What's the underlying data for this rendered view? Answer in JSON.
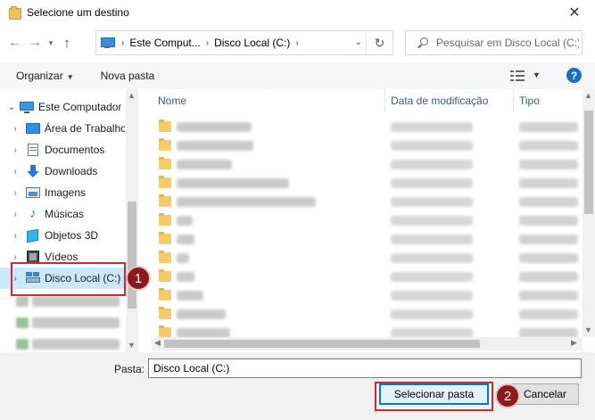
{
  "window": {
    "title": "Selecione um destino"
  },
  "address": {
    "crumbs": [
      "Este Comput...",
      "Disco Local (C:)"
    ],
    "search_placeholder": "Pesquisar em Disco Local (C:)"
  },
  "toolbar": {
    "organize": "Organizar",
    "new_folder": "Nova pasta"
  },
  "nav": {
    "items": [
      {
        "label": "Este Computador",
        "icon": "computer-icon"
      },
      {
        "label": "Área de Trabalho",
        "icon": "desktop-icon"
      },
      {
        "label": "Documentos",
        "icon": "documents-icon"
      },
      {
        "label": "Downloads",
        "icon": "downloads-icon"
      },
      {
        "label": "Imagens",
        "icon": "pictures-icon"
      },
      {
        "label": "Músicas",
        "icon": "music-icon"
      },
      {
        "label": "Objetos 3D",
        "icon": "objects-3d-icon"
      },
      {
        "label": "Vídeos",
        "icon": "videos-icon"
      },
      {
        "label": "Disco Local (C:)",
        "icon": "drive-icon"
      }
    ]
  },
  "columns": {
    "name": "Nome",
    "modified": "Data de modificação",
    "type": "Tipo"
  },
  "footer": {
    "folder_label": "Pasta:",
    "folder_value": "Disco Local (C:)",
    "select_button": "Selecionar pasta",
    "cancel_button": "Cancelar"
  },
  "annotations": {
    "step1": "1",
    "step2": "2"
  },
  "colors": {
    "highlight": "#cc2b2b",
    "badge": "#8d1a1a",
    "accent": "#0078d7",
    "selection": "#cce8ff"
  }
}
